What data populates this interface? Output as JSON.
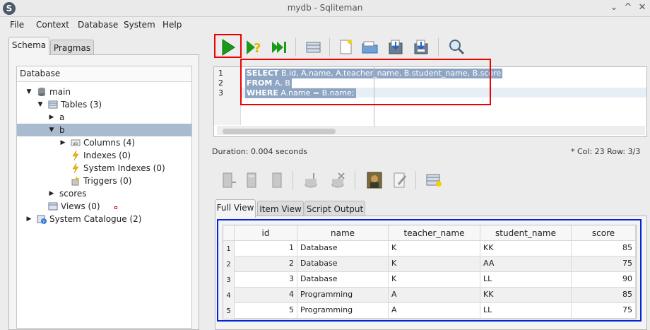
{
  "window": {
    "title": "mydb - Sqliteman",
    "app_icon_letter": "S",
    "controls": [
      "⌄",
      "^",
      "✕"
    ]
  },
  "menu": [
    "File",
    "Context",
    "Database",
    "System",
    "Help"
  ],
  "left_tabs": [
    {
      "label": "Schema",
      "active": true
    },
    {
      "label": "Pragmas",
      "active": false
    }
  ],
  "tree": {
    "header": "Database",
    "nodes": [
      {
        "label": "main",
        "level": 0,
        "arrow": "down",
        "icon": "database-icon"
      },
      {
        "label": "Tables (3)",
        "level": 1,
        "arrow": "down",
        "icon": "table-icon"
      },
      {
        "label": "a",
        "level": 2,
        "arrow": "right",
        "icon": ""
      },
      {
        "label": "b",
        "level": 2,
        "arrow": "down",
        "icon": "",
        "selected": true
      },
      {
        "label": "Columns (4)",
        "level": 3,
        "arrow": "right",
        "icon": "columns-icon"
      },
      {
        "label": "Indexes (0)",
        "level": 3,
        "arrow": "",
        "icon": "lightning-icon"
      },
      {
        "label": "System Indexes (0)",
        "level": 3,
        "arrow": "",
        "icon": "lightning-icon"
      },
      {
        "label": "Triggers (0)",
        "level": 3,
        "arrow": "",
        "icon": "trigger-icon"
      },
      {
        "label": "scores",
        "level": 2,
        "arrow": "right",
        "icon": ""
      },
      {
        "label": "Views (0)",
        "level": 1,
        "arrow": "",
        "icon": "views-icon"
      },
      {
        "label": "System Catalogue (2)",
        "level": 0,
        "arrow": "right",
        "icon": "catalogue-icon"
      }
    ]
  },
  "editor": {
    "lines": [
      {
        "num": "1",
        "kw": "SELECT",
        "rest": " B.id, A.name, A.teacher_name, B.student_name, B.score"
      },
      {
        "num": "2",
        "kw": "FROM",
        "rest": " A, B"
      },
      {
        "num": "3",
        "kw": "WHERE",
        "rest": " A.name = B.name;"
      }
    ]
  },
  "status": {
    "duration": "Duration: 0.004 seconds",
    "position": "*  Col: 23 Row: 3/3"
  },
  "result_tabs": [
    {
      "label": "Full View",
      "active": true
    },
    {
      "label": "Item View",
      "active": false
    },
    {
      "label": "Script Output",
      "active": false
    }
  ],
  "grid": {
    "columns": [
      "id",
      "name",
      "teacher_name",
      "student_name",
      "score"
    ],
    "rows": [
      {
        "row": "1",
        "id": "1",
        "name": "Database",
        "teacher_name": "K",
        "student_name": "KK",
        "score": "85"
      },
      {
        "row": "2",
        "id": "2",
        "name": "Database",
        "teacher_name": "K",
        "student_name": "AA",
        "score": "75"
      },
      {
        "row": "3",
        "id": "3",
        "name": "Database",
        "teacher_name": "K",
        "student_name": "LL",
        "score": "90"
      },
      {
        "row": "4",
        "id": "4",
        "name": "Programming",
        "teacher_name": "A",
        "student_name": "KK",
        "score": "85"
      },
      {
        "row": "5",
        "id": "5",
        "name": "Programming",
        "teacher_name": "A",
        "student_name": "LL",
        "score": "75"
      }
    ]
  },
  "colors": {
    "selection": "#a9bccf",
    "highlight_red": "#e00000",
    "highlight_blue": "#0026d8",
    "run_green": "#1a9a1a"
  }
}
